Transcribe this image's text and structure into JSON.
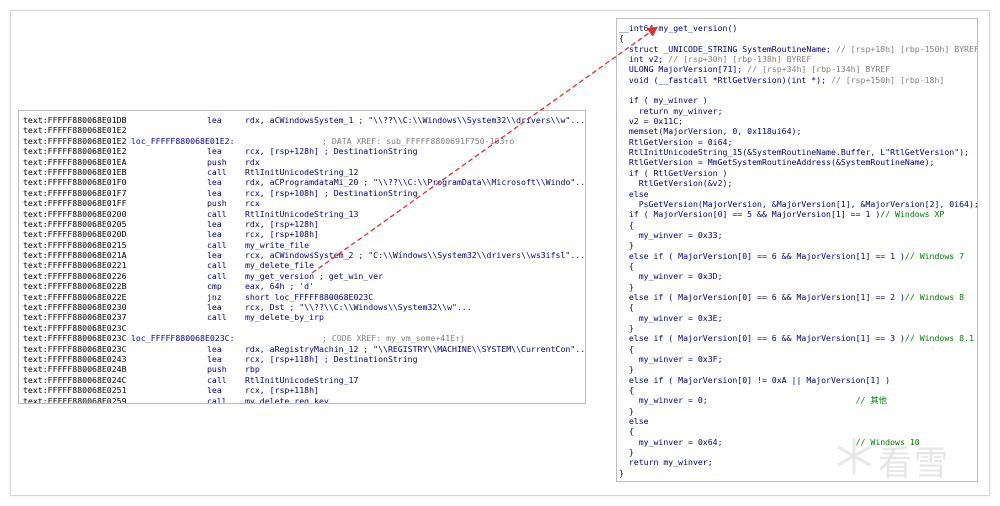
{
  "asm": {
    "lines": [
      {
        "addr": "text:FFFFF880068E01DB",
        "label": "",
        "mnem": "lea",
        "ops": "rdx, aCWindowsSystem_1 ; \"\\\\??\\\\C:\\\\Windows\\\\System32\\\\drivers\\\\w\"...",
        "xref": ""
      },
      {
        "addr": "text:FFFFF880068E01E2",
        "label": "",
        "mnem": "",
        "ops": "",
        "xref": ""
      },
      {
        "addr": "text:FFFFF880068E01E2",
        "label": "loc_FFFFF880068E01E2:",
        "mnem": "",
        "ops": "",
        "xref": "; DATA XREF: sub_FFFFF8800691F750-103↑o"
      },
      {
        "addr": "text:FFFFF880068E01E2",
        "label": "",
        "mnem": "lea",
        "ops": "rcx, [rsp+128h] ; DestinationString",
        "xref": ""
      },
      {
        "addr": "text:FFFFF880068E01EA",
        "label": "",
        "mnem": "push",
        "ops": "rdx",
        "xref": ""
      },
      {
        "addr": "text:FFFFF880068E01EB",
        "label": "",
        "mnem": "call",
        "ops": "RtlInitUnicodeString_12",
        "xref": ""
      },
      {
        "addr": "text:FFFFF880068E01F0",
        "label": "",
        "mnem": "lea",
        "ops": "rdx, aCProgramdataMi_20 ; \"\\\\??\\\\C:\\\\ProgramData\\\\Microsoft\\\\Windo\"...",
        "xref": ""
      },
      {
        "addr": "text:FFFFF880068E01F7",
        "label": "",
        "mnem": "lea",
        "ops": "rcx, [rsp+108h] ; DestinationString",
        "xref": ""
      },
      {
        "addr": "text:FFFFF880068E01FF",
        "label": "",
        "mnem": "push",
        "ops": "rcx",
        "xref": ""
      },
      {
        "addr": "text:FFFFF880068E0200",
        "label": "",
        "mnem": "call",
        "ops": "RtlInitUnicodeString_13",
        "xref": ""
      },
      {
        "addr": "text:FFFFF880068E0205",
        "label": "",
        "mnem": "lea",
        "ops": "rdx, [rsp+128h]",
        "xref": ""
      },
      {
        "addr": "text:FFFFF880068E020D",
        "label": "",
        "mnem": "lea",
        "ops": "rcx, [rsp+108h]",
        "xref": ""
      },
      {
        "addr": "text:FFFFF880068E0215",
        "label": "",
        "mnem": "call",
        "ops": "my_write_file",
        "xref": ""
      },
      {
        "addr": "text:FFFFF880068E021A",
        "label": "",
        "mnem": "lea",
        "ops": "rcx, aCWindowsSystem_2 ; \"C:\\\\Windows\\\\System32\\\\drivers\\\\ws3ifsl\"...",
        "xref": ""
      },
      {
        "addr": "text:FFFFF880068E0221",
        "label": "",
        "mnem": "call",
        "ops": "my_delete_file",
        "xref": ""
      },
      {
        "addr": "text:FFFFF880068E0226",
        "label": "",
        "mnem": "call",
        "ops": "my_get_version ; get_win_ver",
        "xref": ""
      },
      {
        "addr": "text:FFFFF880068E022B",
        "label": "",
        "mnem": "cmp",
        "ops": "eax, 64h ; 'd'",
        "xref": ""
      },
      {
        "addr": "text:FFFFF880068E022E",
        "label": "",
        "mnem": "jnz",
        "ops": "short loc_FFFFF880068E023C",
        "xref": ""
      },
      {
        "addr": "text:FFFFF880068E0230",
        "label": "",
        "mnem": "lea",
        "ops": "rcx, Dst      ; \"\\\\??\\\\C:\\\\Windows\\\\System32\\\\w\"...",
        "xref": ""
      },
      {
        "addr": "text:FFFFF880068E0237",
        "label": "",
        "mnem": "call",
        "ops": "my_delete_by_irp",
        "xref": ""
      },
      {
        "addr": "text:FFFFF880068E023C",
        "label": "",
        "mnem": "",
        "ops": "",
        "xref": ""
      },
      {
        "addr": "text:FFFFF880068E023C",
        "label": "loc_FFFFF880068E023C:",
        "mnem": "",
        "ops": "",
        "xref": "; CODE XREF: my_vm_some+41E↑j"
      },
      {
        "addr": "text:FFFFF880068E023C",
        "label": "",
        "mnem": "lea",
        "ops": "rdx, aRegistryMachin_12 ; \"\\\\REGISTRY\\\\MACHINE\\\\SYSTEM\\\\CurrentCon\"...",
        "xref": ""
      },
      {
        "addr": "text:FFFFF880068E0243",
        "label": "",
        "mnem": "lea",
        "ops": "rcx, [rsp+118h] ; DestinationString",
        "xref": ""
      },
      {
        "addr": "text:FFFFF880068E024B",
        "label": "",
        "mnem": "push",
        "ops": "rbp",
        "xref": ""
      },
      {
        "addr": "text:FFFFF880068E024C",
        "label": "",
        "mnem": "call",
        "ops": "RtlInitUnicodeString_17",
        "xref": ""
      },
      {
        "addr": "text:FFFFF880068E0251",
        "label": "",
        "mnem": "lea",
        "ops": "rcx, [rsp+118h]",
        "xref": ""
      },
      {
        "addr": "text:FFFFF880068E0259",
        "label": "",
        "mnem": "call",
        "ops": "my_delete_reg_key",
        "xref": ""
      }
    ]
  },
  "pseudo": {
    "lines": [
      "__int64 my_get_version()",
      "{",
      "  struct _UNICODE_STRING SystemRoutineName; // [rsp+18h] [rbp-150h] BYREF",
      "  int v2; // [rsp+30h] [rbp-138h] BYREF",
      "  ULONG MajorVersion[71]; // [rsp+34h] [rbp-134h] BYREF",
      "  void (__fastcall *RtlGetVersion)(int *); // [rsp+150h] [rbp-18h]",
      "",
      "  if ( my_winver )",
      "    return my_winver;",
      "  v2 = 0x11C;",
      "  memset(MajorVersion, 0, 0x118ui64);",
      "  RtlGetVersion = 0i64;",
      "  RtlInitUnicodeString_15(&SystemRoutineName.Buffer, L\"RtlGetVersion\");",
      "  RtlGetVersion = MmGetSystemRoutineAddress(&SystemRoutineName);",
      "  if ( RtlGetVersion )",
      "    RtlGetVersion(&v2);",
      "  else",
      "    PsGetVersion(MajorVersion, &MajorVersion[1], &MajorVersion[2], 0i64);",
      "  if ( MajorVersion[0] == 5 && MajorVersion[1] == 1 )// Windows XP",
      "  {",
      "    my_winver = 0x33;",
      "  }",
      "  else if ( MajorVersion[0] == 6 && MajorVersion[1] == 1 )// Windows 7",
      "  {",
      "    my_winver = 0x3D;",
      "  }",
      "  else if ( MajorVersion[0] == 6 && MajorVersion[1] == 2 )// Windows 8",
      "  {",
      "    my_winver = 0x3E;",
      "  }",
      "  else if ( MajorVersion[0] == 6 && MajorVersion[1] == 3 )// Windows 8.1",
      "  {",
      "    my_winver = 0x3F;",
      "  }",
      "  else if ( MajorVersion[0] != 0xA || MajorVersion[1] )",
      "  {",
      "    my_winver = 0;                              // 其他",
      "  }",
      "  else",
      "  {",
      "    my_winver = 0x64;                           // Windows 10",
      "  }",
      "  return my_winver;",
      "}"
    ]
  },
  "watermark": {
    "text": "看雪"
  },
  "colors": {
    "arrow": "#e03030",
    "code_blue": "#000080",
    "comment_gray": "#808080",
    "comment_green": "#008000",
    "var_blue": "#6a7abf"
  }
}
